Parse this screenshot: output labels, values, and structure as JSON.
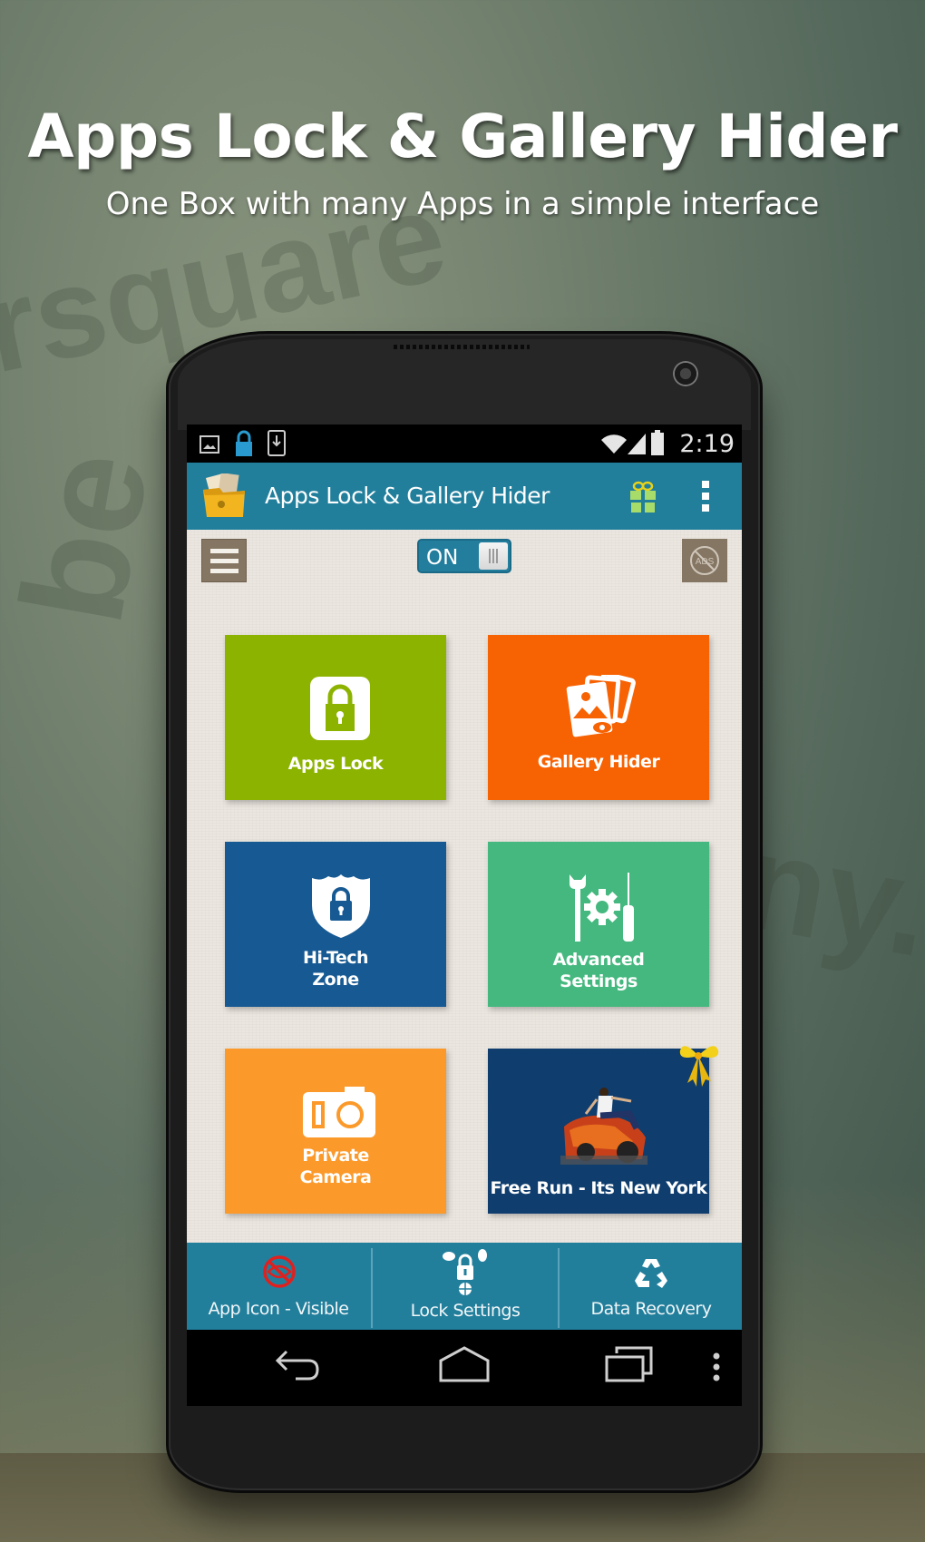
{
  "promo": {
    "title": "Apps Lock & Gallery Hider",
    "subtitle": "One Box with many Apps in a simple interface"
  },
  "status_bar": {
    "left_icons": [
      "image-icon",
      "lock-icon",
      "download-icon"
    ],
    "right_icons": [
      "wifi-icon",
      "signal-icon",
      "battery-icon"
    ],
    "time": "2:19"
  },
  "action_bar": {
    "title": "Apps Lock & Gallery Hider",
    "icons": [
      "app-logo-icon",
      "gift-icon",
      "overflow-menu-icon"
    ]
  },
  "controls": {
    "menu_icon": "hamburger-menu-icon",
    "toggle_label": "ON",
    "toggle_state": true,
    "noads_icon": "no-ads-icon",
    "noads_text": "ADS"
  },
  "tiles": [
    {
      "label_lines": [
        "Apps Lock"
      ],
      "icon": "padlock-icon",
      "color": "#8db301"
    },
    {
      "label_lines": [
        "Gallery Hider"
      ],
      "icon": "photos-eye-icon",
      "color": "#f76203"
    },
    {
      "label_lines": [
        "Hi-Tech",
        "Zone"
      ],
      "icon": "shield-lock-icon",
      "color": "#175a93"
    },
    {
      "label_lines": [
        "Advanced",
        "Settings"
      ],
      "icon": "tools-gear-icon",
      "color": "#45b87f"
    },
    {
      "label_lines": [
        "Private",
        "Camera"
      ],
      "icon": "camera-icon",
      "color": "#fb9a2b"
    },
    {
      "label_lines": [
        "Free Run - Its New York"
      ],
      "icon": "game-thumbnail",
      "color": "#0f3d6e",
      "badge": "ribbon-bow-icon"
    }
  ],
  "bottom_bar": [
    {
      "label": "App Icon - Visible",
      "icon": "eye-hidden-icon"
    },
    {
      "label": "Lock Settings",
      "icon": "lock-settings-icon"
    },
    {
      "label": "Data Recovery",
      "icon": "recycle-icon"
    }
  ],
  "nav_bar": [
    "back-icon",
    "home-icon",
    "recent-apps-icon",
    "menu-dots-icon"
  ],
  "colors": {
    "accent": "#227f9c",
    "brown_button": "#857663",
    "content_bg": "#ebe6df"
  }
}
